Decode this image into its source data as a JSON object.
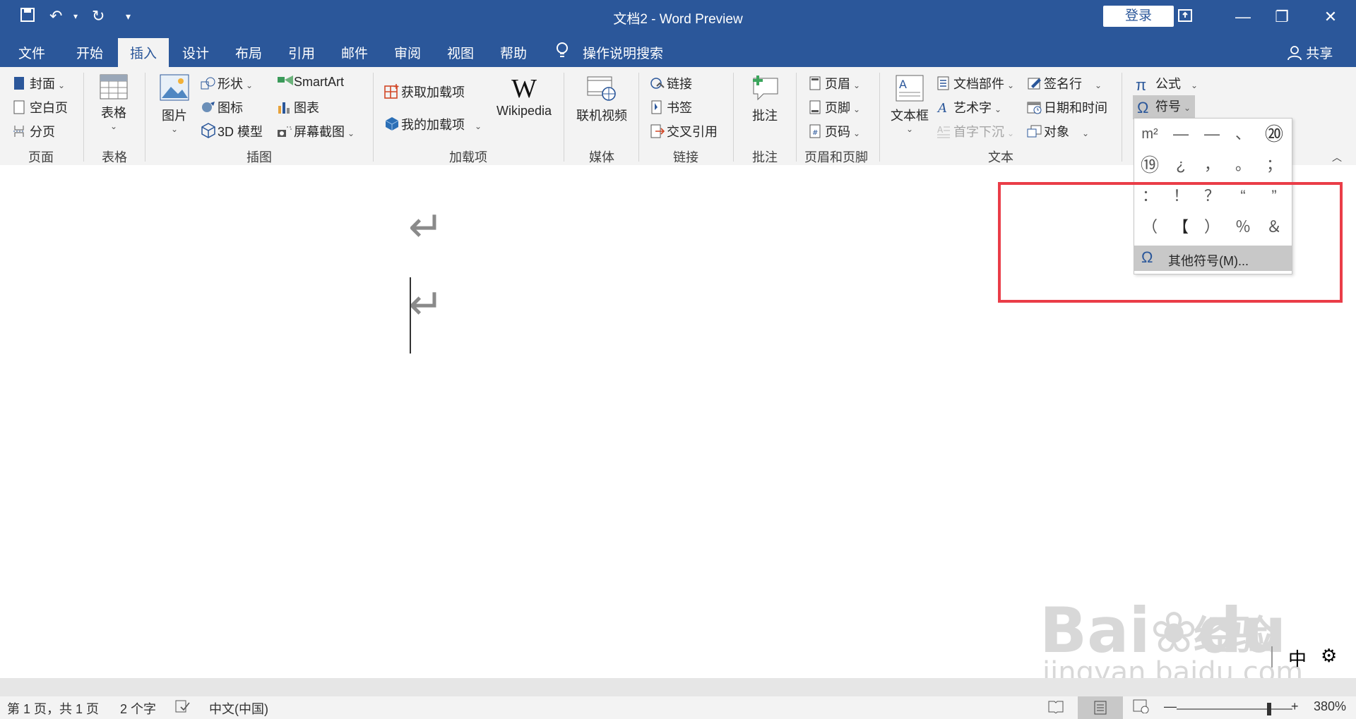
{
  "window": {
    "title": "文档2  -  Word Preview",
    "login_label": "登录",
    "share_label": "共享"
  },
  "menu": {
    "tabs": [
      "文件",
      "开始",
      "插入",
      "设计",
      "布局",
      "引用",
      "邮件",
      "审阅",
      "视图",
      "帮助"
    ],
    "active_tab": "插入",
    "search_label": "操作说明搜索"
  },
  "ribbon": {
    "pages": {
      "cover": "封面",
      "blank": "空白页",
      "break": "分页",
      "group": "页面"
    },
    "table": {
      "label": "表格",
      "group": "表格"
    },
    "illus": {
      "picture": "图片",
      "shapes": "形状",
      "icons": "图标",
      "model3d": "3D 模型",
      "smartart": "SmartArt",
      "chart": "图表",
      "screenshot": "屏幕截图",
      "group": "插图"
    },
    "addins": {
      "get": "获取加载项",
      "mine": "我的加载项",
      "wiki": "Wikipedia",
      "group": "加载项"
    },
    "media": {
      "video": "联机视频",
      "group": "媒体"
    },
    "links": {
      "link": "链接",
      "bookmark": "书签",
      "xref": "交叉引用",
      "group": "链接"
    },
    "comments": {
      "comment": "批注",
      "group": "批注"
    },
    "hf": {
      "header": "页眉",
      "footer": "页脚",
      "pagenum": "页码",
      "group": "页眉和页脚"
    },
    "text": {
      "textbox": "文本框",
      "parts": "文档部件",
      "wordart": "艺术字",
      "dropcap": "首字下沉",
      "sigline": "签名行",
      "datetime": "日期和时间",
      "object": "对象",
      "group": "文本"
    },
    "symbols": {
      "equation": "公式",
      "symbol": "符号"
    }
  },
  "symbol_dropdown": {
    "symbols": [
      "m²",
      "—",
      "—",
      "、",
      "⑳",
      "⑲",
      "¿",
      "，",
      "。",
      "；",
      "：",
      "！",
      "？",
      "“",
      "”",
      "（",
      "【",
      "）",
      "％",
      "＆"
    ],
    "more_label": "其他符号(M)..."
  },
  "statusbar": {
    "page": "第 1 页，共 1 页",
    "words": "2 个字",
    "lang": "中文(中国)",
    "zoom": "380%",
    "ime": "中"
  },
  "watermark": {
    "brand": "Bai",
    "brand2": "du",
    "cn": "经验",
    "url": "jingyan.baidu.com"
  },
  "colors": {
    "accent": "#2b579a",
    "highlight": "#ea3d48"
  }
}
